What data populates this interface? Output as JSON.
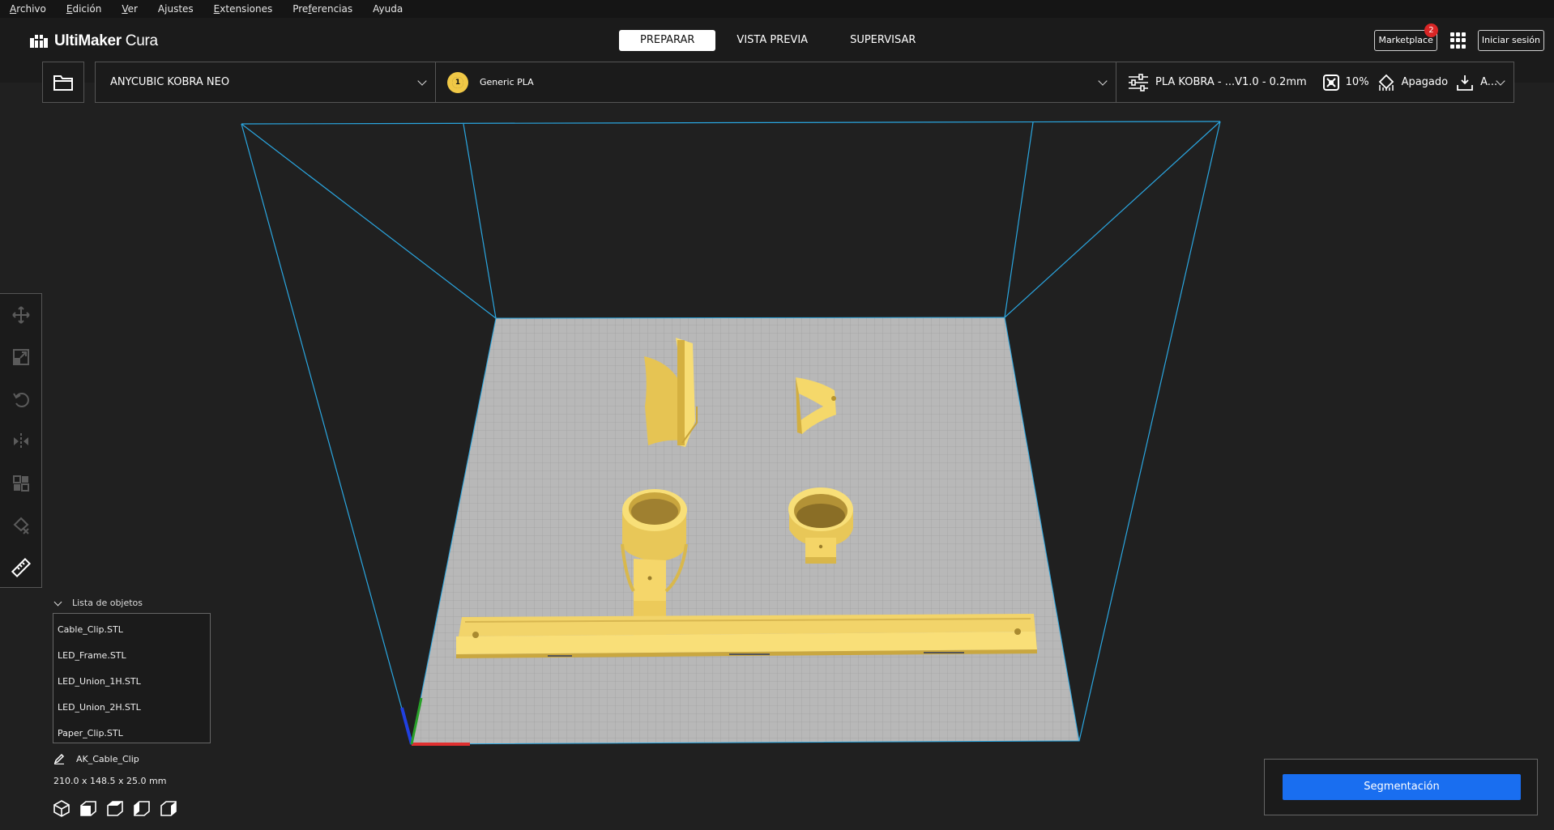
{
  "menu": [
    "Archivo",
    "Edición",
    "Ver",
    "Ajustes",
    "Extensiones",
    "Preferencias",
    "Ayuda"
  ],
  "menu_mnemonics": [
    "A",
    "E",
    "V",
    "",
    "E",
    "f",
    ""
  ],
  "app": {
    "logo_bold": "UltiMaker",
    "logo_light": " Cura"
  },
  "stages": [
    {
      "label": "PREPARAR",
      "active": true
    },
    {
      "label": "VISTA PREVIA",
      "active": false
    },
    {
      "label": "SUPERVISAR",
      "active": false
    }
  ],
  "header_right": {
    "marketplace": "Marketplace",
    "marketplace_badge": "2",
    "signin": "Iniciar sesión"
  },
  "printer": {
    "name": "ANYCUBIC KOBRA NEO"
  },
  "material": {
    "extruder": "1",
    "name": "Generic PLA"
  },
  "print_settings": {
    "profile": "PLA KOBRA - ...V1.0 - 0.2mm",
    "infill": "10%",
    "support": "Apagado",
    "adhesion": "A..."
  },
  "object_list": {
    "title": "Lista de objetos",
    "items": [
      "Cable_Clip.STL",
      "LED_Frame.STL",
      "LED_Union_1H.STL",
      "LED_Union_2H.STL",
      "Paper_Clip.STL"
    ]
  },
  "selected_object": {
    "name": "AK_Cable_Clip",
    "dimensions": "210.0 x 148.5 x 25.0 mm"
  },
  "action": {
    "slice_label": "Segmentación"
  },
  "colors": {
    "accent": "#196ef0",
    "model": "#f5d86a",
    "build_volume": "#2aa6e0",
    "background": "#202020"
  },
  "tools": [
    "move-icon",
    "scale-icon",
    "rotate-icon",
    "mirror-icon",
    "per-model-settings-icon",
    "support-blocker-icon",
    "measure-icon"
  ]
}
